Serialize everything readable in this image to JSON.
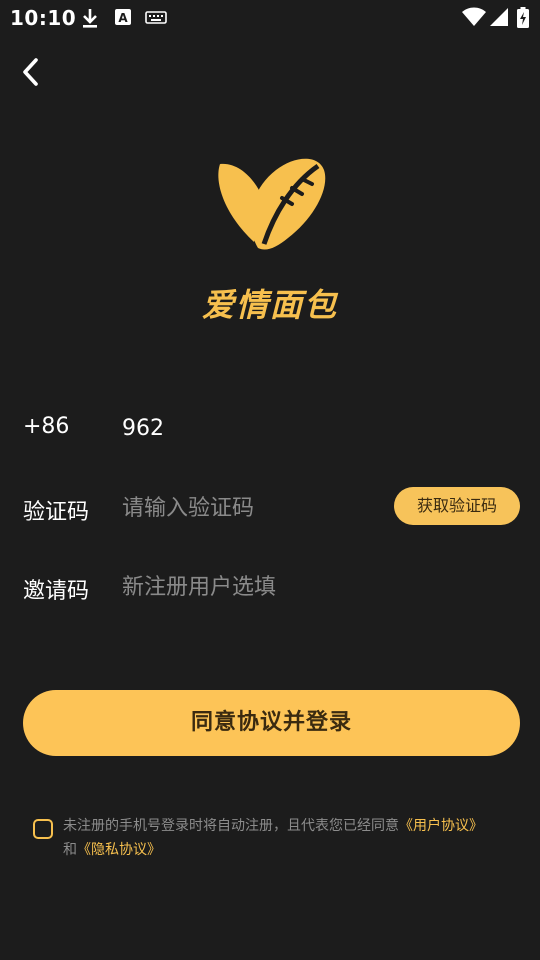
{
  "status_bar": {
    "time": "10:10",
    "icons": [
      "download-icon",
      "a-box-icon",
      "keyboard-icon",
      "wifi-icon",
      "signal-icon",
      "battery-charging-icon"
    ]
  },
  "brand": {
    "name": "爱情面包",
    "accent_color": "#f7c04e"
  },
  "phone": {
    "country_code": "+86",
    "value": "962"
  },
  "code": {
    "label": "验证码",
    "placeholder": "请输入验证码",
    "button_label": "获取验证码"
  },
  "invite": {
    "label": "邀请码",
    "placeholder": "新注册用户选填"
  },
  "login_button": "同意协议并登录",
  "agreement": {
    "text": "未注册的手机号登录时将自动注册，且代表您已经同意",
    "user_agreement": "《用户协议》",
    "conjunction": "和",
    "privacy_policy": "《隐私协议》"
  }
}
